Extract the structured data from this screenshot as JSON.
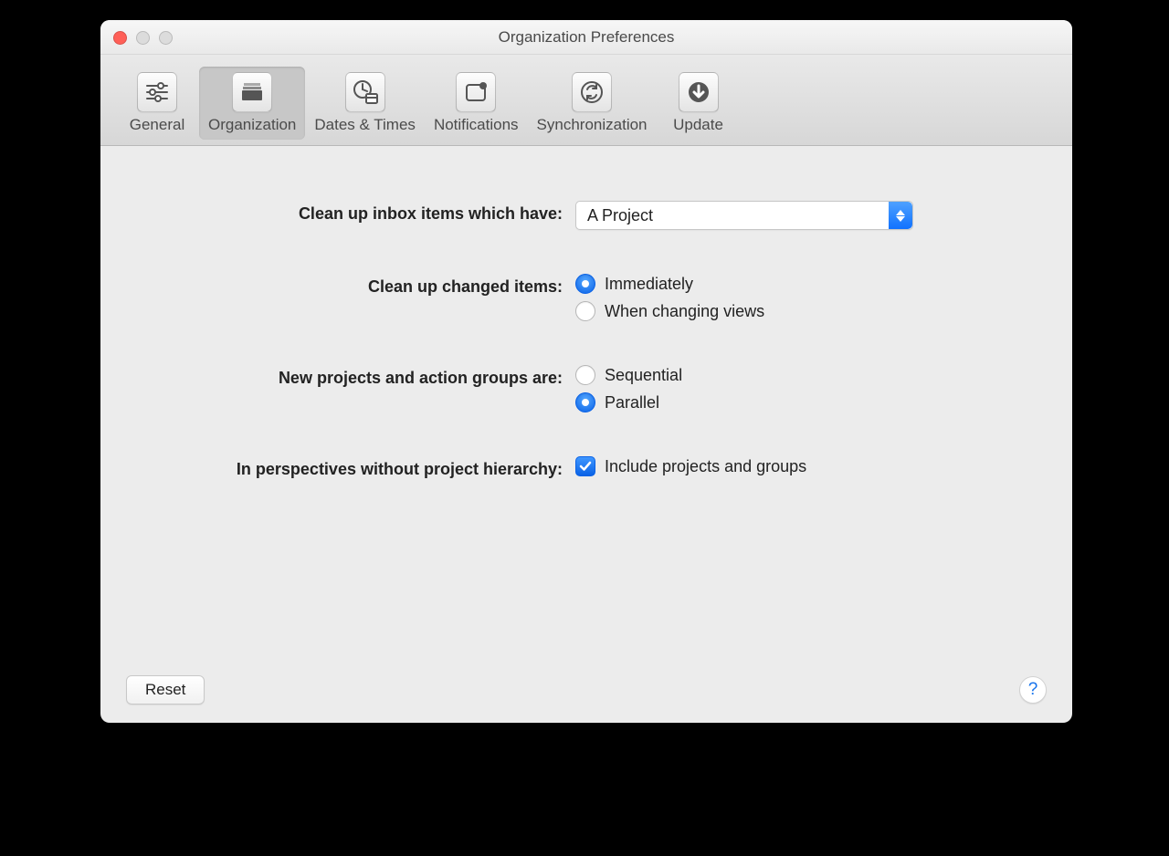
{
  "window": {
    "title": "Organization Preferences"
  },
  "tabs": [
    {
      "label": "General"
    },
    {
      "label": "Organization"
    },
    {
      "label": "Dates & Times"
    },
    {
      "label": "Notifications"
    },
    {
      "label": "Synchronization"
    },
    {
      "label": "Update"
    }
  ],
  "form": {
    "cleanup_inbox_label": "Clean up inbox items which have:",
    "cleanup_inbox_value": "A Project",
    "cleanup_changed_label": "Clean up changed items:",
    "cleanup_changed_options": {
      "immediately": "Immediately",
      "when_changing": "When changing views"
    },
    "new_projects_label": "New projects and action groups are:",
    "new_projects_options": {
      "sequential": "Sequential",
      "parallel": "Parallel"
    },
    "perspectives_label": "In perspectives without project hierarchy:",
    "perspectives_check": "Include projects and groups"
  },
  "footer": {
    "reset": "Reset",
    "help": "?"
  }
}
